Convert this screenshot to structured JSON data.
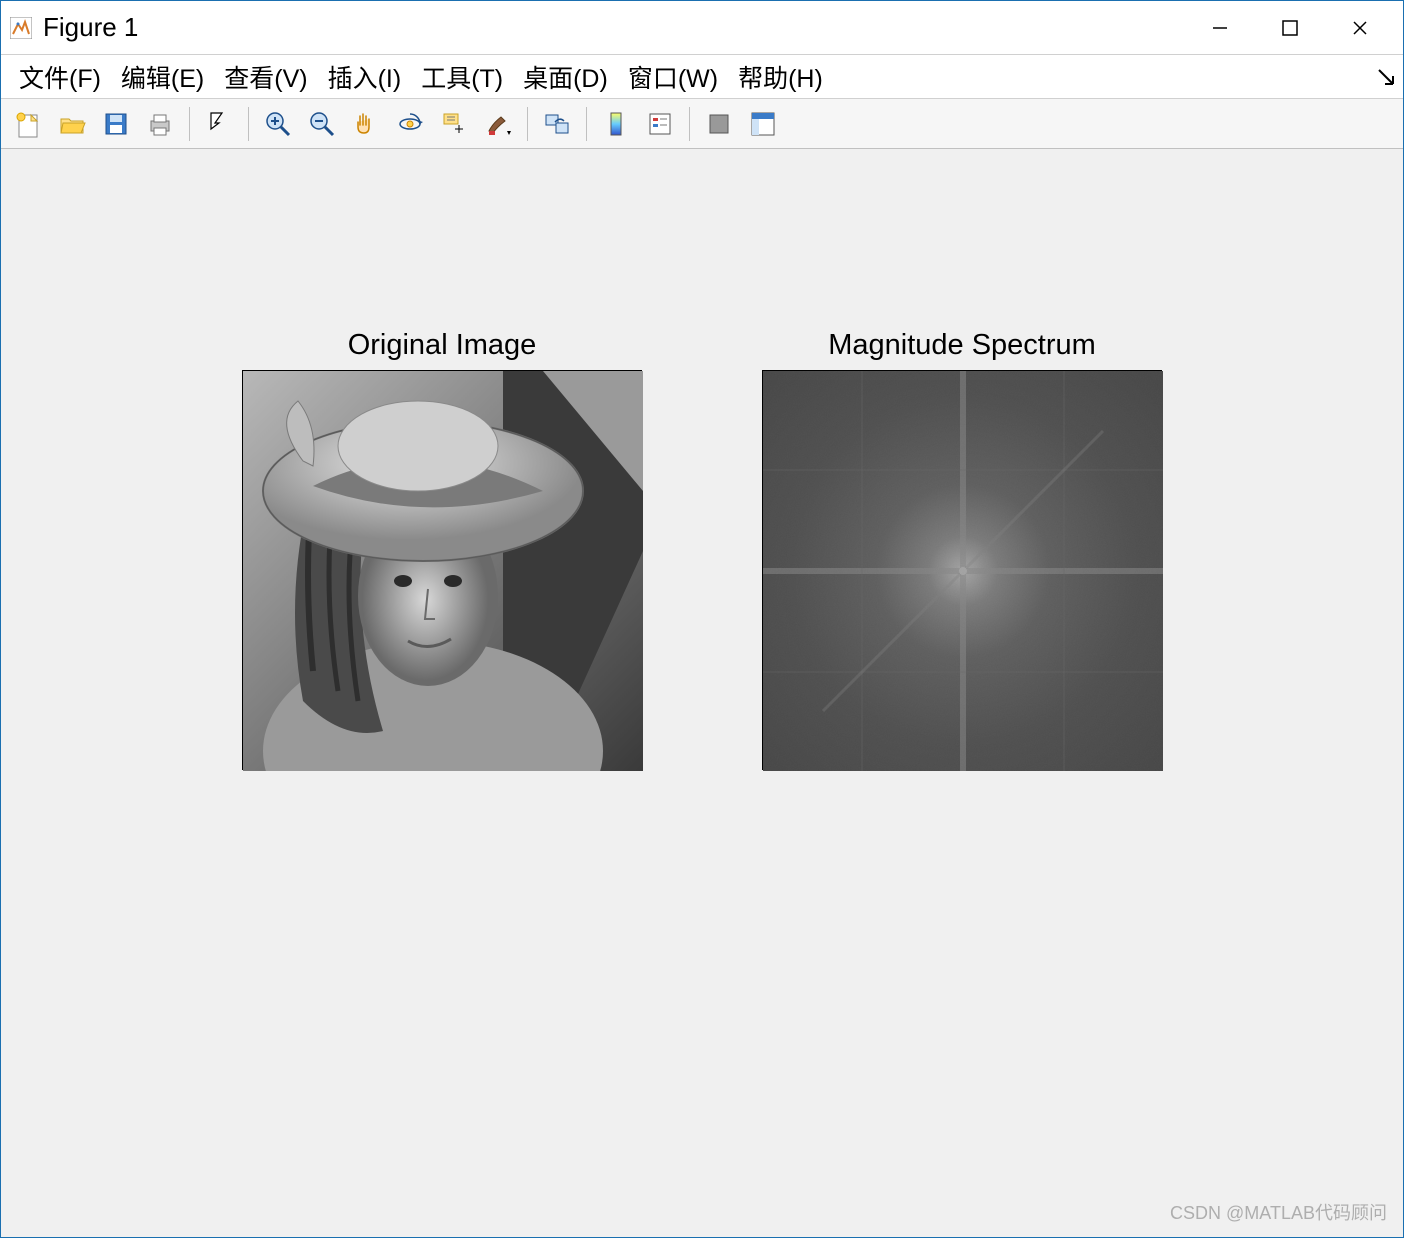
{
  "window": {
    "title": "Figure 1"
  },
  "menu": {
    "file": "文件(F)",
    "edit": "编辑(E)",
    "view": "查看(V)",
    "insert": "插入(I)",
    "tools": "工具(T)",
    "desktop": "桌面(D)",
    "window_menu": "窗口(W)",
    "help": "帮助(H)"
  },
  "subplots": {
    "left_title": "Original Image",
    "right_title": "Magnitude Spectrum"
  },
  "watermark": "CSDN @MATLAB代码顾问",
  "toolbar_icons": {
    "new": "new-figure-icon",
    "open": "open-icon",
    "save": "save-icon",
    "print": "print-icon",
    "pointer": "pointer-icon",
    "zoom_in": "zoom-in-icon",
    "zoom_out": "zoom-out-icon",
    "pan": "pan-icon",
    "rotate": "rotate-3d-icon",
    "datacursor": "data-cursor-icon",
    "brush": "brush-icon",
    "link": "link-plots-icon",
    "colorbar": "colorbar-icon",
    "legend": "legend-icon",
    "hide": "hide-tools-icon",
    "show": "show-tools-icon"
  }
}
